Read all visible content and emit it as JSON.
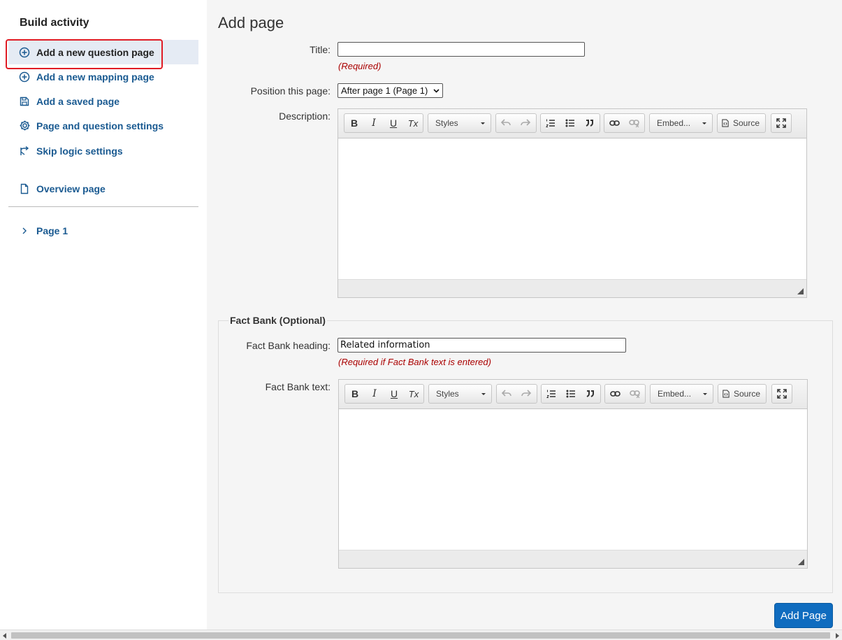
{
  "sidebar": {
    "title": "Build activity",
    "items": [
      {
        "label": "Add a new question page",
        "icon": "plus-circle-icon"
      },
      {
        "label": "Add a new mapping page",
        "icon": "plus-circle-icon"
      },
      {
        "label": "Add a saved page",
        "icon": "save-icon"
      },
      {
        "label": "Page and question settings",
        "icon": "gear-icon"
      },
      {
        "label": "Skip logic settings",
        "icon": "branch-icon"
      },
      {
        "label": "Overview page",
        "icon": "file-icon"
      },
      {
        "label": "Page 1",
        "icon": "chevron-right-icon"
      }
    ]
  },
  "form": {
    "heading": "Add page",
    "title_label": "Title:",
    "title_value": "",
    "required_text": "(Required)",
    "position_label": "Position this page:",
    "position_value": "After page 1 (Page 1)",
    "description_label": "Description:",
    "factbank_legend": "Fact Bank (Optional)",
    "factbank_heading_label": "Fact Bank heading:",
    "factbank_heading_value": "Related information",
    "factbank_required_text": "(Required if Fact Bank text is entered)",
    "factbank_text_label": "Fact Bank text:",
    "submit_label": "Add Page"
  },
  "editor_toolbar": {
    "bold": "B",
    "italic": "I",
    "underline": "U",
    "clear_format": "Tx",
    "styles_label": "Styles",
    "embed_label": "Embed...",
    "source_label": "Source"
  },
  "colors": {
    "link": "#1a5a91",
    "primary": "#0f6cbf",
    "required": "#aa0000",
    "highlight": "#e01b24"
  }
}
